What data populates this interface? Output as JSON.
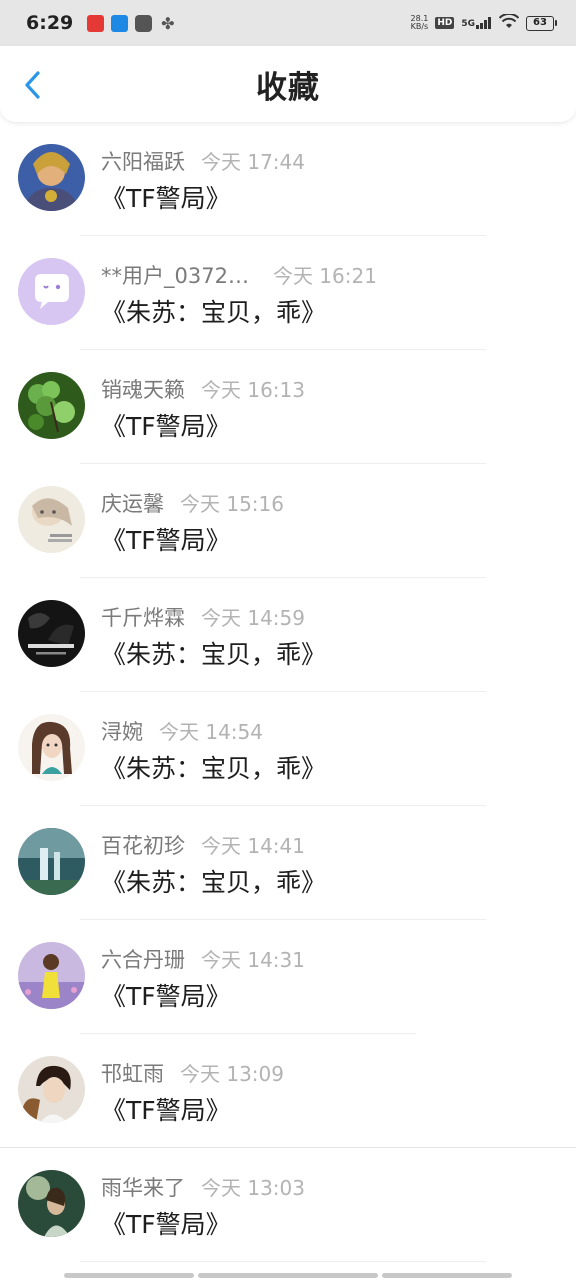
{
  "status_bar": {
    "time": "6:29",
    "net_speed_value": "28.1",
    "net_speed_unit": "KB/s",
    "hd": "HD",
    "signal": "5G",
    "battery": "63"
  },
  "header": {
    "title": "收藏",
    "back_icon": "chevron-left-icon",
    "accent_color": "#2a96e8"
  },
  "favorites": [
    {
      "user": "六阳福跃",
      "time": "今天 17:44",
      "title": "《TF警局》"
    },
    {
      "user": "**用户_0372…",
      "time": "今天 16:21",
      "title": "《朱苏：宝贝，乖》"
    },
    {
      "user": "销魂天籁",
      "time": "今天 16:13",
      "title": "《TF警局》"
    },
    {
      "user": "庆运馨",
      "time": "今天 15:16",
      "title": "《TF警局》"
    },
    {
      "user": "千斤烨霖",
      "time": "今天 14:59",
      "title": "《朱苏：宝贝，乖》"
    },
    {
      "user": "浔婉",
      "time": "今天 14:54",
      "title": "《朱苏：宝贝，乖》"
    },
    {
      "user": "百花初珍",
      "time": "今天 14:41",
      "title": "《朱苏：宝贝，乖》"
    },
    {
      "user": "六合丹珊",
      "time": "今天 14:31",
      "title": "《TF警局》"
    },
    {
      "user": "邗虹雨",
      "time": "今天 13:09",
      "title": "《TF警局》"
    },
    {
      "user": "雨华来了",
      "time": "今天 13:03",
      "title": "《TF警局》"
    }
  ]
}
